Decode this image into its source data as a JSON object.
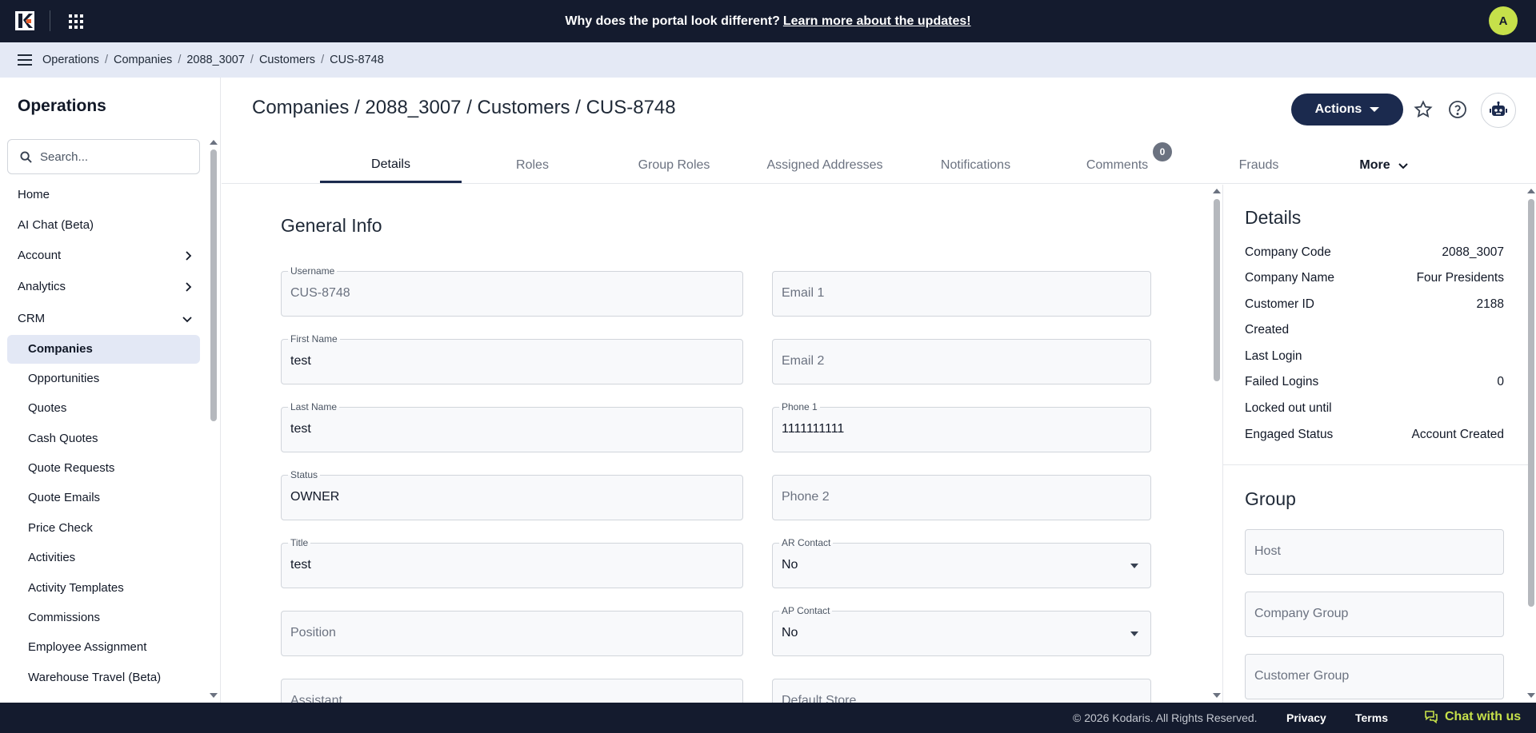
{
  "topbar": {
    "announcement_text": "Why does the portal look different?",
    "announcement_link": "Learn more about the updates!",
    "avatar_initial": "A"
  },
  "breadcrumb": [
    "Operations",
    "Companies",
    "2088_3007",
    "Customers",
    "CUS-8748"
  ],
  "sidebar": {
    "title": "Operations",
    "search_placeholder": "Search...",
    "items": [
      {
        "label": "Home"
      },
      {
        "label": "AI Chat (Beta)"
      },
      {
        "label": "Account",
        "chevron": "right"
      },
      {
        "label": "Analytics",
        "chevron": "right"
      },
      {
        "label": "CRM",
        "chevron": "down"
      }
    ],
    "crm_subitems": [
      "Companies",
      "Opportunities",
      "Quotes",
      "Cash Quotes",
      "Quote Requests",
      "Quote Emails",
      "Price Check",
      "Activities",
      "Activity Templates",
      "Commissions",
      "Employee Assignment",
      "Warehouse Travel (Beta)"
    ],
    "active_subitem": "Companies"
  },
  "header": {
    "title": "Companies / 2088_3007 / Customers / CUS-8748",
    "actions_label": "Actions"
  },
  "tabs": [
    {
      "label": "Details",
      "active": true
    },
    {
      "label": "Roles"
    },
    {
      "label": "Group Roles"
    },
    {
      "label": "Assigned Addresses"
    },
    {
      "label": "Notifications"
    },
    {
      "label": "Comments",
      "badge": "0"
    },
    {
      "label": "Frauds"
    },
    {
      "label": "More"
    }
  ],
  "general_info": {
    "title": "General Info",
    "fields": {
      "username": {
        "label": "Username",
        "value": "CUS-8748"
      },
      "email1": {
        "placeholder": "Email 1"
      },
      "first_name": {
        "label": "First Name",
        "value": "test"
      },
      "email2": {
        "placeholder": "Email 2"
      },
      "last_name": {
        "label": "Last Name",
        "value": "test"
      },
      "phone1": {
        "label": "Phone 1",
        "value": "1111111111"
      },
      "status": {
        "label": "Status",
        "value": "OWNER"
      },
      "phone2": {
        "placeholder": "Phone 2"
      },
      "title": {
        "label": "Title",
        "value": "test"
      },
      "ar_contact": {
        "label": "AR Contact",
        "value": "No"
      },
      "position": {
        "placeholder": "Position"
      },
      "ap_contact": {
        "label": "AP Contact",
        "value": "No"
      },
      "assistant": {
        "placeholder": "Assistant"
      },
      "default_store": {
        "placeholder": "Default Store"
      }
    }
  },
  "details_panel": {
    "title": "Details",
    "rows": [
      {
        "label": "Company Code",
        "value": "2088_3007"
      },
      {
        "label": "Company Name",
        "value": "Four Presidents"
      },
      {
        "label": "Customer ID",
        "value": "2188"
      },
      {
        "label": "Created",
        "value": ""
      },
      {
        "label": "Last Login",
        "value": ""
      },
      {
        "label": "Failed Logins",
        "value": "0"
      },
      {
        "label": "Locked out until",
        "value": ""
      },
      {
        "label": "Engaged Status",
        "value": "Account Created"
      }
    ]
  },
  "group_panel": {
    "title": "Group",
    "fields": [
      "Host",
      "Company Group",
      "Customer Group"
    ]
  },
  "footer": {
    "copyright": "© 2026 Kodaris. All Rights Reserved.",
    "privacy": "Privacy",
    "terms": "Terms",
    "chat": "Chat with us"
  },
  "colors": {
    "navy": "#141b2e",
    "accent_green": "#c6e04a",
    "actions_blue": "#1b2a4e",
    "crumb_bg": "#e4e9f5"
  }
}
